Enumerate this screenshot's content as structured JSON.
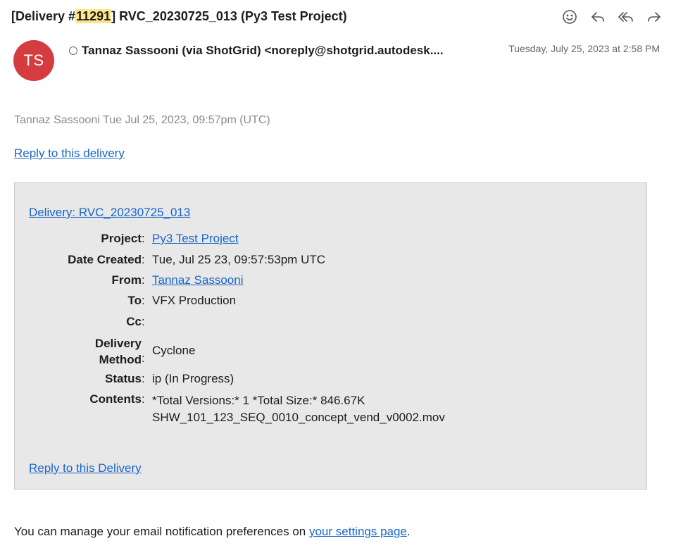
{
  "subject": {
    "prefix": "[Delivery #",
    "number": "11291",
    "suffix": "] RVC_20230725_013 (Py3 Test Project)"
  },
  "toolbar": {
    "icons": [
      "smiley-icon",
      "reply-icon",
      "reply-all-icon",
      "forward-icon"
    ]
  },
  "sender": {
    "initials": "TS",
    "name": "Tannaz Sassooni (via ShotGrid) <noreply@shotgrid.autodesk....",
    "date": "Tuesday, July 25, 2023 at 2:58 PM"
  },
  "body": {
    "meta": "Tannaz Sassooni Tue Jul 25, 2023, 09:57pm (UTC)",
    "reply_top": "Reply to this delivery",
    "box_title": "Delivery: RVC_20230725_013",
    "fields": {
      "project_label": "Project",
      "project_value": "Py3 Test Project",
      "date_label": "Date Created",
      "date_value": "Tue, Jul 25 23, 09:57:53pm UTC",
      "from_label": "From",
      "from_value": "Tannaz Sassooni",
      "to_label": "To",
      "to_value": "VFX Production",
      "cc_label": "Cc",
      "cc_value": "",
      "method_label_1": "Delivery",
      "method_label_2": "Method",
      "method_value": "Cyclone",
      "status_label": "Status",
      "status_value": "ip (In Progress)",
      "contents_label": "Contents",
      "contents_line1": "*Total Versions:* 1 *Total Size:* 846.67K",
      "contents_line2": "SHW_101_123_SEQ_0010_concept_vend_v0002.mov"
    },
    "colon": ":",
    "reply_bottom": "Reply to this Delivery",
    "footer_text": "You can manage your email notification preferences on ",
    "footer_link": "your settings page",
    "footer_end": "."
  }
}
